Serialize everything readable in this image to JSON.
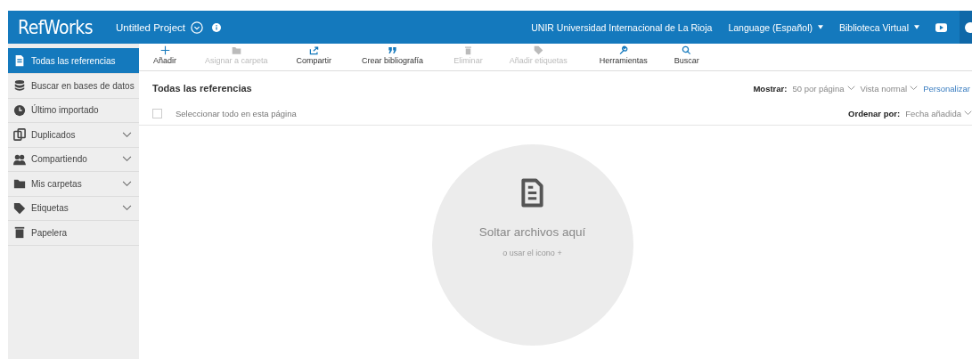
{
  "header": {
    "logo": "RefWorks",
    "project": "Untitled Project",
    "institution": "UNIR Universidad Internacional de La Rioja",
    "language_menu": "Language (Español)",
    "library_menu": "Biblioteca Virtual"
  },
  "sidebar": {
    "items": [
      {
        "label": "Todas las referencias",
        "selected": true,
        "expandable": false
      },
      {
        "label": "Buscar en bases de datos",
        "selected": false,
        "expandable": false
      },
      {
        "label": "Último importado",
        "selected": false,
        "expandable": false
      },
      {
        "label": "Duplicados",
        "selected": false,
        "expandable": true
      },
      {
        "label": "Compartiendo",
        "selected": false,
        "expandable": true
      },
      {
        "label": "Mis carpetas",
        "selected": false,
        "expandable": true
      },
      {
        "label": "Etiquetas",
        "selected": false,
        "expandable": true
      },
      {
        "label": "Papelera",
        "selected": false,
        "expandable": false
      }
    ]
  },
  "toolbar": [
    {
      "label": "Añadir",
      "disabled": false
    },
    {
      "label": "Asignar a carpeta",
      "disabled": true
    },
    {
      "label": "Compartir",
      "disabled": false
    },
    {
      "label": "Crear bibliografía",
      "disabled": false
    },
    {
      "label": "Eliminar",
      "disabled": true
    },
    {
      "label": "Añadir etiquetas",
      "disabled": true
    },
    {
      "label": "Herramientas",
      "disabled": false
    },
    {
      "label": "Buscar",
      "disabled": false
    }
  ],
  "content": {
    "title": "Todas las referencias",
    "show_label": "Mostrar:",
    "per_page": "50 por página",
    "view": "Vista normal",
    "customize": "Personalizar",
    "select_all": {
      "label": "Seleccionar todo en esta página",
      "checked": false
    },
    "sort_label": "Ordenar por:",
    "sort_value": "Fecha añadida",
    "drop_title": "Soltar archivos aquí",
    "drop_hint": "o usar el icono +"
  }
}
